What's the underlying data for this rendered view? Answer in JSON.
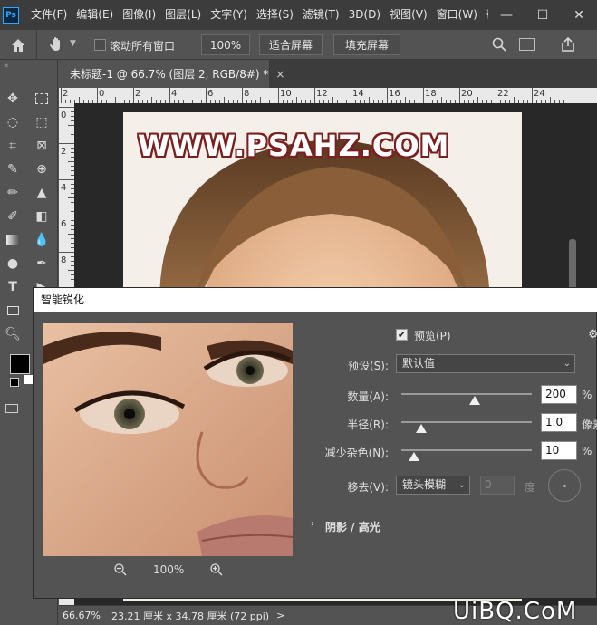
{
  "app": {
    "logo_text": "Ps"
  },
  "menu": [
    "文件(F)",
    "编辑(E)",
    "图像(I)",
    "图层(L)",
    "文字(Y)",
    "选择(S)",
    "滤镜(T)",
    "3D(D)",
    "视图(V)",
    "窗口(W)",
    "帮"
  ],
  "window_controls": {
    "minimize": "—",
    "maximize": "☐",
    "close": "✕"
  },
  "options_bar": {
    "scroll_all_windows_label": "滚动所有窗口",
    "zoom_100_label": "100%",
    "fit_screen_label": "适合屏幕",
    "fill_screen_label": "填充屏幕"
  },
  "document": {
    "tab_title": "未标题-1 @ 66.7% (图层 2, RGB/8#) *",
    "tab_close": "×",
    "watermark": "WWW.PSAHZ.COM",
    "ruler_top_labels": [
      "2",
      "0",
      "2",
      "4",
      "6",
      "8",
      "10",
      "12",
      "14",
      "16",
      "18",
      "20",
      "22",
      "24"
    ],
    "ruler_left_labels": [
      "0",
      "2",
      "4",
      "6",
      "8",
      "1",
      "1",
      "1"
    ]
  },
  "status_bar": {
    "zoom": "66.67%",
    "doc_size": "23.21 厘米 x 34.78 厘米 (72 ppi)",
    "arrow": ">"
  },
  "site_watermark": "UiBQ.CoM",
  "dialog": {
    "title": "智能锐化",
    "preview_label": "预览(P)",
    "preview_checked": true,
    "preset_label": "预设(S):",
    "preset_value": "默认值",
    "amount_label": "数量(A):",
    "amount_value": "200",
    "amount_unit": "%",
    "amount_level": 0.56,
    "radius_label": "半径(R):",
    "radius_value": "1.0",
    "radius_unit": "像素",
    "radius_level": 0.15,
    "noise_label": "减少杂色(N):",
    "noise_value": "10",
    "noise_unit": "%",
    "noise_level": 0.1,
    "remove_label": "移去(V):",
    "remove_value": "镜头模糊",
    "angle_value": "0",
    "angle_unit": "度",
    "shadows_label": "阴影 / 高光",
    "zoom_level": "100%",
    "zoom_out_icon": "zoom-out",
    "zoom_in_icon": "zoom-in"
  }
}
